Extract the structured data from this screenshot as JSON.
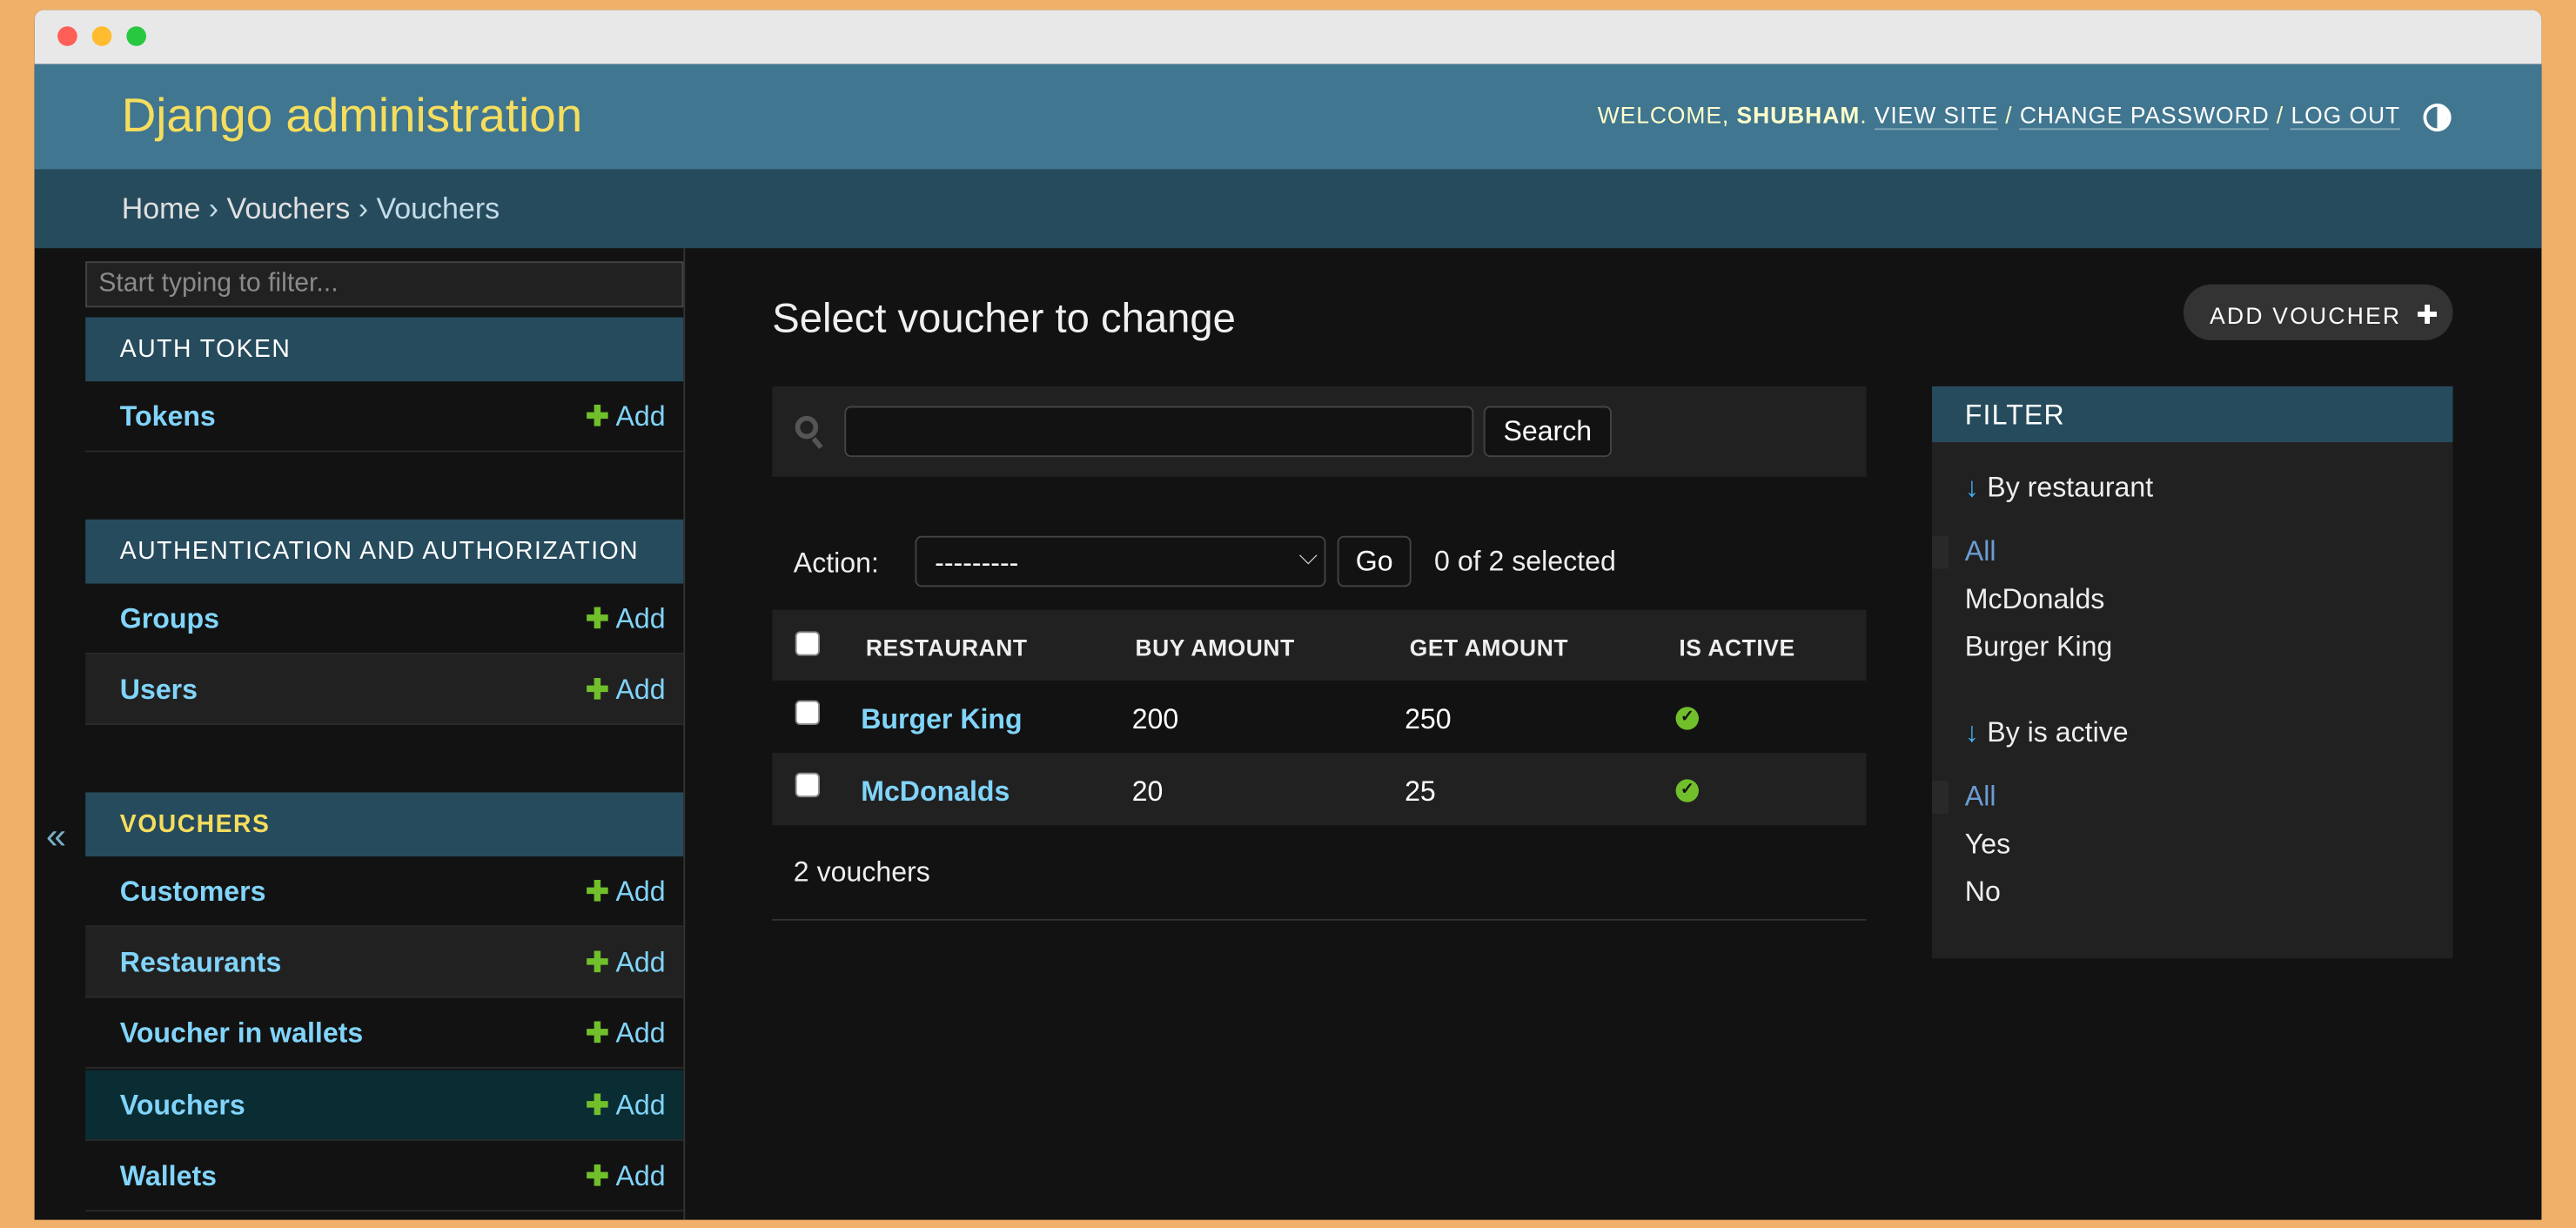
{
  "header": {
    "brand": "Django administration",
    "welcome": "WELCOME, ",
    "user": "SHUBHAM",
    "links": [
      "VIEW SITE",
      "CHANGE PASSWORD",
      "LOG OUT"
    ],
    "separator": " / "
  },
  "breadcrumbs": [
    "Home",
    "Vouchers",
    "Vouchers"
  ],
  "breadcrumb_sep": " › ",
  "sidebar": {
    "collapse": "«",
    "filter_placeholder": "Start typing to filter...",
    "add_label": "Add",
    "sections": [
      {
        "caption": "AUTH TOKEN",
        "items": [
          "Tokens"
        ]
      },
      {
        "caption": "AUTHENTICATION AND AUTHORIZATION",
        "items": [
          "Groups",
          "Users"
        ]
      },
      {
        "caption": "VOUCHERS",
        "current": true,
        "items": [
          "Customers",
          "Restaurants",
          "Voucher in wallets",
          "Vouchers",
          "Wallets"
        ],
        "selected": "Vouchers"
      }
    ]
  },
  "main": {
    "title": "Select voucher to change",
    "add_button": "ADD VOUCHER",
    "search": {
      "value": "",
      "button": "Search"
    },
    "actions": {
      "label": "Action:",
      "selected": "---------",
      "go": "Go",
      "count": "0 of 2 selected"
    },
    "table": {
      "columns": [
        "RESTAURANT",
        "BUY AMOUNT",
        "GET AMOUNT",
        "IS ACTIVE"
      ],
      "rows": [
        {
          "restaurant": "Burger King",
          "buy": "200",
          "get": "250",
          "active": true
        },
        {
          "restaurant": "McDonalds",
          "buy": "20",
          "get": "25",
          "active": true
        }
      ]
    },
    "paginator": "2 vouchers"
  },
  "filter": {
    "title": "FILTER",
    "groups": [
      {
        "title": "By restaurant",
        "options": [
          "All",
          "McDonalds",
          "Burger King"
        ],
        "selected": "All"
      },
      {
        "title": "By is active",
        "options": [
          "All",
          "Yes",
          "No"
        ],
        "selected": "All"
      }
    ]
  },
  "colors": {
    "header": "#417690",
    "breadcrumbs": "#264b5d",
    "brand": "#f5dd5d",
    "link": "#81d4fa",
    "add": "#70bf2b",
    "background": "#121212"
  }
}
